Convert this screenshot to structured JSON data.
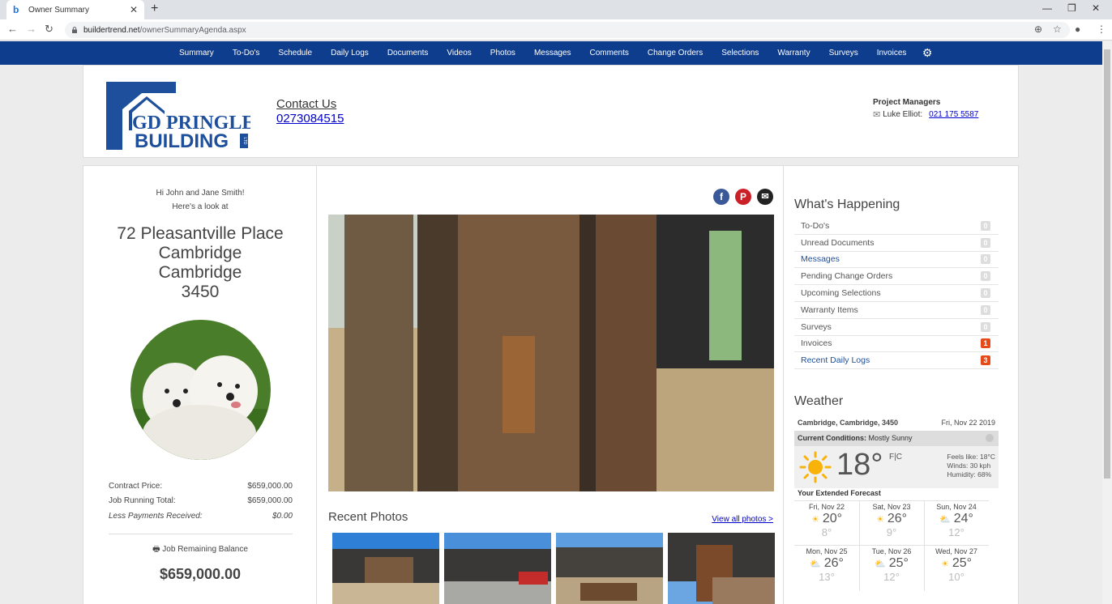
{
  "browser": {
    "tab_title": "Owner Summary",
    "url_host": "buildertrend.net",
    "url_path": "/ownerSummaryAgenda.aspx"
  },
  "nav": {
    "items": [
      "Summary",
      "To-Do's",
      "Schedule",
      "Daily Logs",
      "Documents",
      "Videos",
      "Photos",
      "Messages",
      "Comments",
      "Change Orders",
      "Selections",
      "Warranty",
      "Surveys",
      "Invoices"
    ]
  },
  "header": {
    "logo_line1": "GD PRINGLE",
    "logo_line2": "BUILDING",
    "logo_ltd": "LTD",
    "contact_label": "Contact Us",
    "contact_phone": "0273084515",
    "pm_title": "Project Managers",
    "pm_name": "Luke Elliot:",
    "pm_phone": "021 175 5587"
  },
  "owner": {
    "greeting": "Hi John and Jane Smith!",
    "subgreeting": "Here's a look at",
    "address_line1": "72 Pleasantville Place",
    "address_line2": "Cambridge",
    "address_line3": "Cambridge",
    "address_line4": "3450",
    "contract_price_label": "Contract Price:",
    "contract_price": "$659,000.00",
    "running_total_label": "Job Running Total:",
    "running_total": "$659,000.00",
    "less_payments_label": "Less Payments Received:",
    "less_payments": "$0.00",
    "remaining_label": "Job Remaining Balance",
    "remaining_value": "$659,000.00"
  },
  "photos": {
    "recent_title": "Recent Photos",
    "view_all": "View all photos >"
  },
  "happening": {
    "title": "What's Happening",
    "items": [
      {
        "label": "To-Do's",
        "count": "0",
        "link": false,
        "hot": false
      },
      {
        "label": "Unread Documents",
        "count": "0",
        "link": false,
        "hot": false
      },
      {
        "label": "Messages",
        "count": "0",
        "link": true,
        "hot": false
      },
      {
        "label": "Pending Change Orders",
        "count": "0",
        "link": false,
        "hot": false
      },
      {
        "label": "Upcoming Selections",
        "count": "0",
        "link": false,
        "hot": false
      },
      {
        "label": "Warranty Items",
        "count": "0",
        "link": false,
        "hot": false
      },
      {
        "label": "Surveys",
        "count": "0",
        "link": false,
        "hot": false
      },
      {
        "label": "Invoices",
        "count": "1",
        "link": false,
        "hot": true
      },
      {
        "label": "Recent Daily Logs",
        "count": "3",
        "link": true,
        "hot": true
      }
    ]
  },
  "weather": {
    "title": "Weather",
    "location": "Cambridge, Cambridge, 3450",
    "date": "Fri, Nov 22 2019",
    "current_label": "Current Conditions:",
    "current_value": "Mostly Sunny",
    "temp": "18°",
    "units": "F|C",
    "feels_like": "Feels like: 18°C",
    "winds": "Winds: 30 kph",
    "humidity": "Humidity: 68%",
    "extended_title": "Your Extended Forecast",
    "forecast": [
      {
        "day": "Fri, Nov 22",
        "hi": "20°",
        "lo": "8°",
        "icon": "sun-icon"
      },
      {
        "day": "Sat, Nov 23",
        "hi": "26°",
        "lo": "9°",
        "icon": "sun-icon"
      },
      {
        "day": "Sun, Nov 24",
        "hi": "24°",
        "lo": "12°",
        "icon": "partly-cloudy-icon"
      },
      {
        "day": "Mon, Nov 25",
        "hi": "26°",
        "lo": "13°",
        "icon": "partly-cloudy-icon"
      },
      {
        "day": "Tue, Nov 26",
        "hi": "25°",
        "lo": "12°",
        "icon": "partly-cloudy-icon"
      },
      {
        "day": "Wed, Nov 27",
        "hi": "25°",
        "lo": "10°",
        "icon": "sun-icon"
      }
    ]
  },
  "colors": {
    "nav_bg": "#0e3d8e",
    "logo_blue": "#1d4f9c",
    "badge_hot": "#e64a19",
    "link_blue": "#0000cc"
  }
}
